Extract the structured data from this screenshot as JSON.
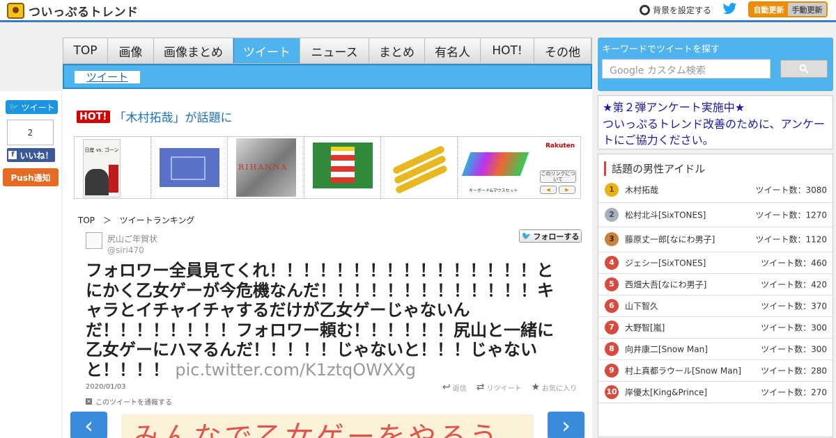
{
  "header": {
    "site_title": "ついっぷるトレンド",
    "bg_setting": "背景を設定する",
    "auto_update": "自動更新",
    "manual_update": "手動更新"
  },
  "nav": {
    "tabs": [
      "TOP",
      "画像",
      "画像まとめ",
      "ツイート",
      "ニュース",
      "まとめ",
      "有名人",
      "HOT!",
      "その他"
    ],
    "active_tab": "ツイート",
    "sub_tab": "ツイート"
  },
  "share": {
    "tweet_label": "ツイート",
    "count": "2",
    "like_label": "いいね！",
    "push_label": "Push通知"
  },
  "hot": {
    "badge": "HOT!",
    "text": "「木村拓哉」が話題に"
  },
  "ad": {
    "rakuten": "Rakuten",
    "link_info": "このリンクについて",
    "book_title": "日産 vs. ゴーン",
    "keyboard_caption": "キーボード&マウスセット"
  },
  "breadcrumb": {
    "top": "TOP",
    "sep": "＞",
    "current": "ツイートランキング"
  },
  "tweet": {
    "follow_label": "フォローする",
    "user_name": "尻山ご年賀状",
    "user_handle": "@siri470",
    "text": "フォロワー全員見てくれ！！！！！！！！！！！！！！！！とにかく乙女ゲーが今危機なんだ！！！！！！！！！！！！！キャラとイチャイチャするだけが乙女ゲーじゃないんだ！！！！！！！！フォロワー頼む！！！！！！尻山と一緒に乙女ゲーにハマるんだ！！！！！じゃないと！！！じゃないと！！！！ ",
    "pic_link": "pic.twitter.com/K1ztqOWXXg",
    "date": "2020/01/03",
    "reply": "返信",
    "retweet": "リツイート",
    "favorite": "お気に入り",
    "report": "このツイートを通報する"
  },
  "slide": {
    "image_text": "みんなで乙女ゲーをやろう"
  },
  "sidebar": {
    "search_label": "キーワードでツイートを探す",
    "search_placeholder": "Google カスタム検索",
    "survey_text": "★第２弾アンケート実施中★\nついっぷるトレンド改善のために、アンケートにご協力ください。",
    "ranking_title": "話題の男性アイドル",
    "ranking": [
      {
        "rank": "1",
        "name": "木村拓哉",
        "count": "ツイート数：3080"
      },
      {
        "rank": "2",
        "name": "松村北斗[SixTONES]",
        "count": "ツイート数：1270"
      },
      {
        "rank": "3",
        "name": "藤原丈一郎[なにわ男子]",
        "count": "ツイート数：1120"
      },
      {
        "rank": "4",
        "name": "ジェシー[SixTONES]",
        "count": "ツイート数：460"
      },
      {
        "rank": "5",
        "name": "西畑大吾[なにわ男子]",
        "count": "ツイート数：420"
      },
      {
        "rank": "6",
        "name": "山下智久",
        "count": "ツイート数：370"
      },
      {
        "rank": "7",
        "name": "大野智[嵐]",
        "count": "ツイート数：300"
      },
      {
        "rank": "8",
        "name": "向井康二[Snow Man]",
        "count": "ツイート数：300"
      },
      {
        "rank": "9",
        "name": "村上真都ラウール[Snow Man]",
        "count": "ツイート数：280"
      },
      {
        "rank": "10",
        "name": "岸優太[King&Prince]",
        "count": "ツイート数：270"
      }
    ]
  }
}
